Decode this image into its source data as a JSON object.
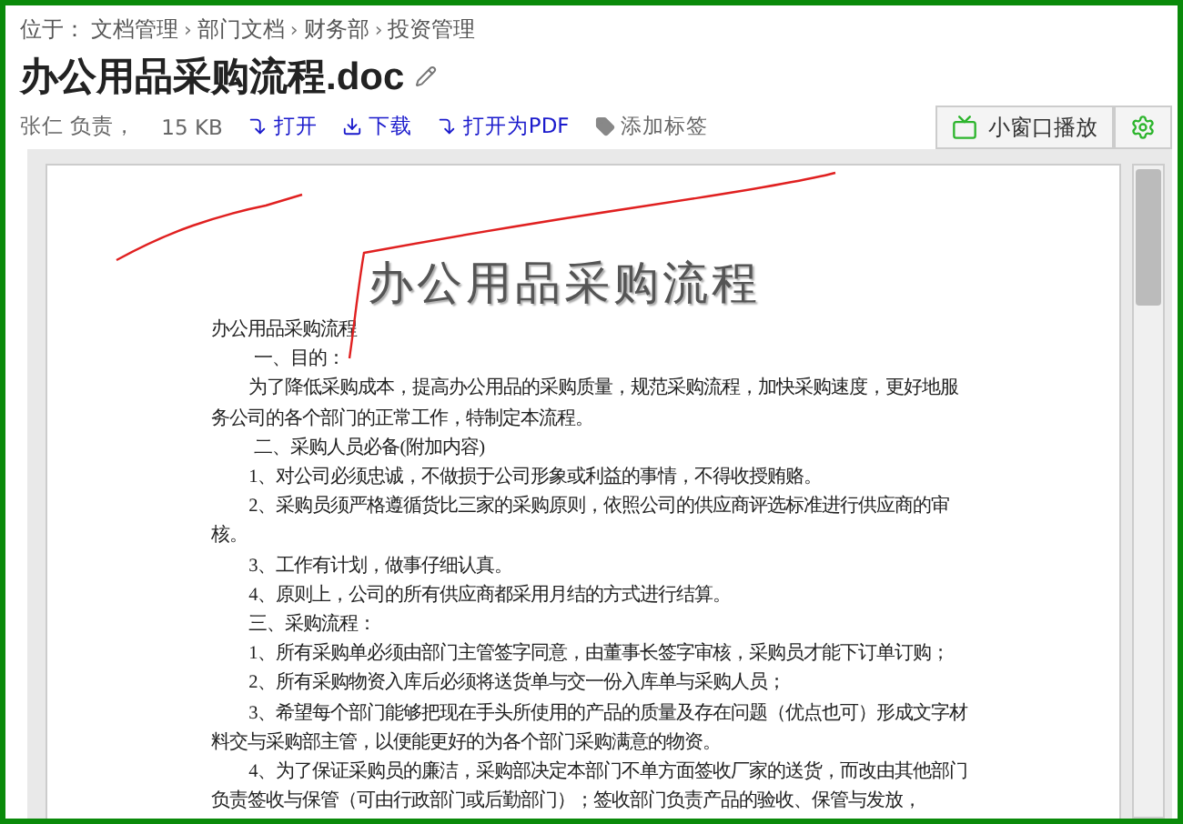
{
  "breadcrumb": {
    "prefix": "位于：",
    "separator": "›",
    "items": [
      "文档管理",
      "部门文档",
      "财务部",
      "投资管理"
    ]
  },
  "title": "办公用品采购流程.doc",
  "meta": {
    "owner": "张仁 负责，",
    "size": "15 KB"
  },
  "actions": [
    {
      "label": "打开",
      "kind": "open"
    },
    {
      "label": "下载",
      "kind": "download"
    },
    {
      "label": "打开为PDF",
      "kind": "open"
    },
    {
      "label": "添加标签",
      "kind": "tag"
    }
  ],
  "window_button": "小窗口播放",
  "document": {
    "heading": "办公用品采购流程",
    "paragraphs": [
      {
        "text": "办公用品采购流程",
        "kind": "plain"
      },
      {
        "text": "一、目的：",
        "kind": "section"
      },
      {
        "text": "为了降低采购成本，提高办公用品的采购质量，规范采购流程，加快采购速度，更好地服务公司的各个部门的正常工作，特制定本流程。",
        "kind": "para"
      },
      {
        "text": "二、采购人员必备(附加内容)",
        "kind": "section"
      },
      {
        "text": "1、对公司必须忠诚，不做损于公司形象或利益的事情，不得收授贿赂。",
        "kind": "para"
      },
      {
        "text": "2、采购员须严格遵循货比三家的采购原则，依照公司的供应商评选标准进行供应商的审核。",
        "kind": "para"
      },
      {
        "text": "3、工作有计划，做事仔细认真。",
        "kind": "para"
      },
      {
        "text": "4、原则上，公司的所有供应商都采用月结的方式进行结算。",
        "kind": "para"
      },
      {
        "text": "三、采购流程：",
        "kind": "para"
      },
      {
        "text": "1、所有采购单必须由部门主管签字同意，由董事长签字审核，采购员才能下订单订购；",
        "kind": "para"
      },
      {
        "text": "2、所有采购物资入库后必须将送货单与交一份入库单与采购人员；",
        "kind": "para"
      },
      {
        "text": "3、希望每个部门能够把现在手头所使用的产品的质量及存在问题（优点也可）形成文字材料交与采购部主管，以便能更好的为各个部门采购满意的物资。",
        "kind": "para"
      },
      {
        "text": "4、为了保证采购员的廉洁，采购部决定本部门不单方面签收厂家的送货，而改由其他部门负责签收与保管（可由行政部门或后勤部门）；签收部门负责产品的验收、保管与发放，",
        "kind": "para"
      }
    ]
  }
}
